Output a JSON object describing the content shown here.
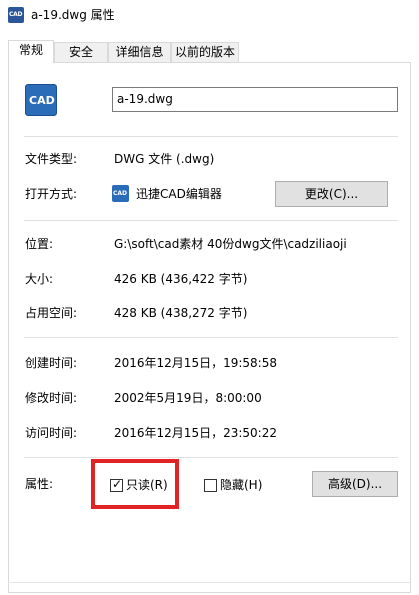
{
  "window": {
    "title": "a-19.dwg 属性",
    "title_icon": "cad-file-icon",
    "title_icon_text": "CAD"
  },
  "tabs": [
    {
      "label": "常规",
      "active": true
    },
    {
      "label": "安全",
      "active": false
    },
    {
      "label": "详细信息",
      "active": false
    },
    {
      "label": "以前的版本",
      "active": false
    }
  ],
  "general": {
    "file_icon_text": "CAD",
    "file_name": "a-19.dwg",
    "file_type_label": "文件类型:",
    "file_type_value": "DWG 文件 (.dwg)",
    "opens_with_label": "打开方式:",
    "opens_with_icon_text": "CAD",
    "opens_with_value": "迅捷CAD编辑器",
    "change_button": "更改(C)...",
    "location_label": "位置:",
    "location_value": "G:\\soft\\cad素材 40份dwg文件\\cadziliaoji",
    "size_label": "大小:",
    "size_value": "426 KB (436,422 字节)",
    "size_on_disk_label": "占用空间:",
    "size_on_disk_value": "428 KB (438,272 字节)",
    "created_label": "创建时间:",
    "created_value": "2016年12月15日，19:58:58",
    "modified_label": "修改时间:",
    "modified_value": "2002年5月19日，8:00:00",
    "accessed_label": "访问时间:",
    "accessed_value": "2016年12月15日，23:50:22",
    "attributes_label": "属性:",
    "readonly_label": "只读(R)",
    "readonly_checked": true,
    "hidden_label": "隐藏(H)",
    "hidden_checked": false,
    "advanced_button": "高级(D)...",
    "highlight_color": "#e02424"
  }
}
